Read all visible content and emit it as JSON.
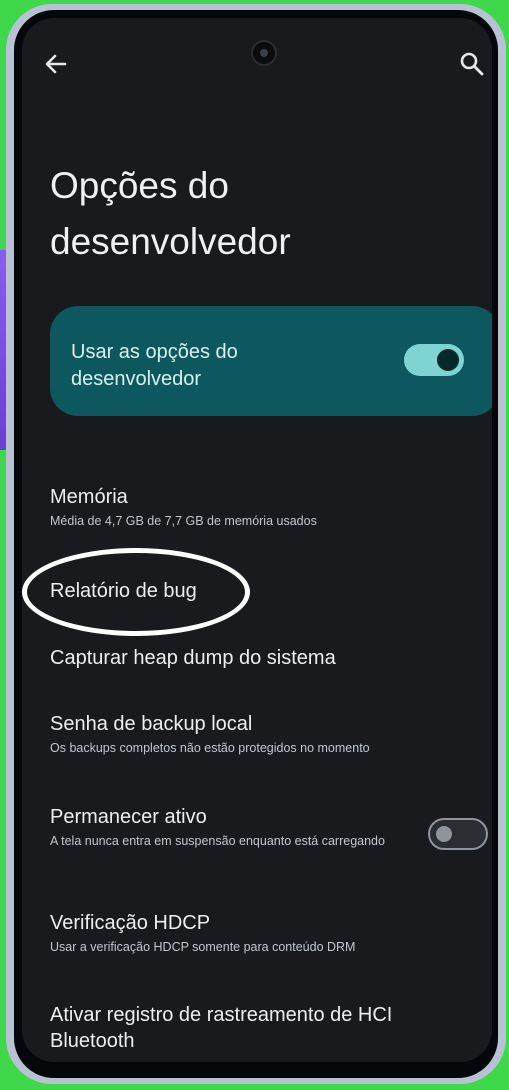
{
  "page": {
    "title": "Opções do desenvolvedor",
    "colors": {
      "accent": "#0d585e",
      "toggle_on": "#7fd3d3",
      "background": "#181a1d",
      "highlight": "#ffffff"
    }
  },
  "toolbar": {
    "back_icon": "arrow-left-icon",
    "search_icon": "search-icon"
  },
  "master_switch": {
    "label": "Usar as opções do desenvolvedor",
    "state": "on"
  },
  "settings": [
    {
      "title": "Memória",
      "subtitle": "Média de 4,7 GB de 7,7 GB de memória usados"
    },
    {
      "title": "Relatório de bug",
      "subtitle": ""
    },
    {
      "title": "Capturar heap dump do sistema",
      "subtitle": ""
    },
    {
      "title": "Senha de backup local",
      "subtitle": "Os backups completos não estão protegidos no momento"
    },
    {
      "title": "Permanecer ativo",
      "subtitle": "A tela nunca entra em suspensão enquanto está carregando",
      "toggle": "off"
    },
    {
      "title": "Verificação HDCP",
      "subtitle": "Usar a verificação HDCP somente para conteúdo DRM"
    },
    {
      "title": "Ativar registro de rastreamento de HCI Bluetooth",
      "subtitle": ""
    }
  ]
}
